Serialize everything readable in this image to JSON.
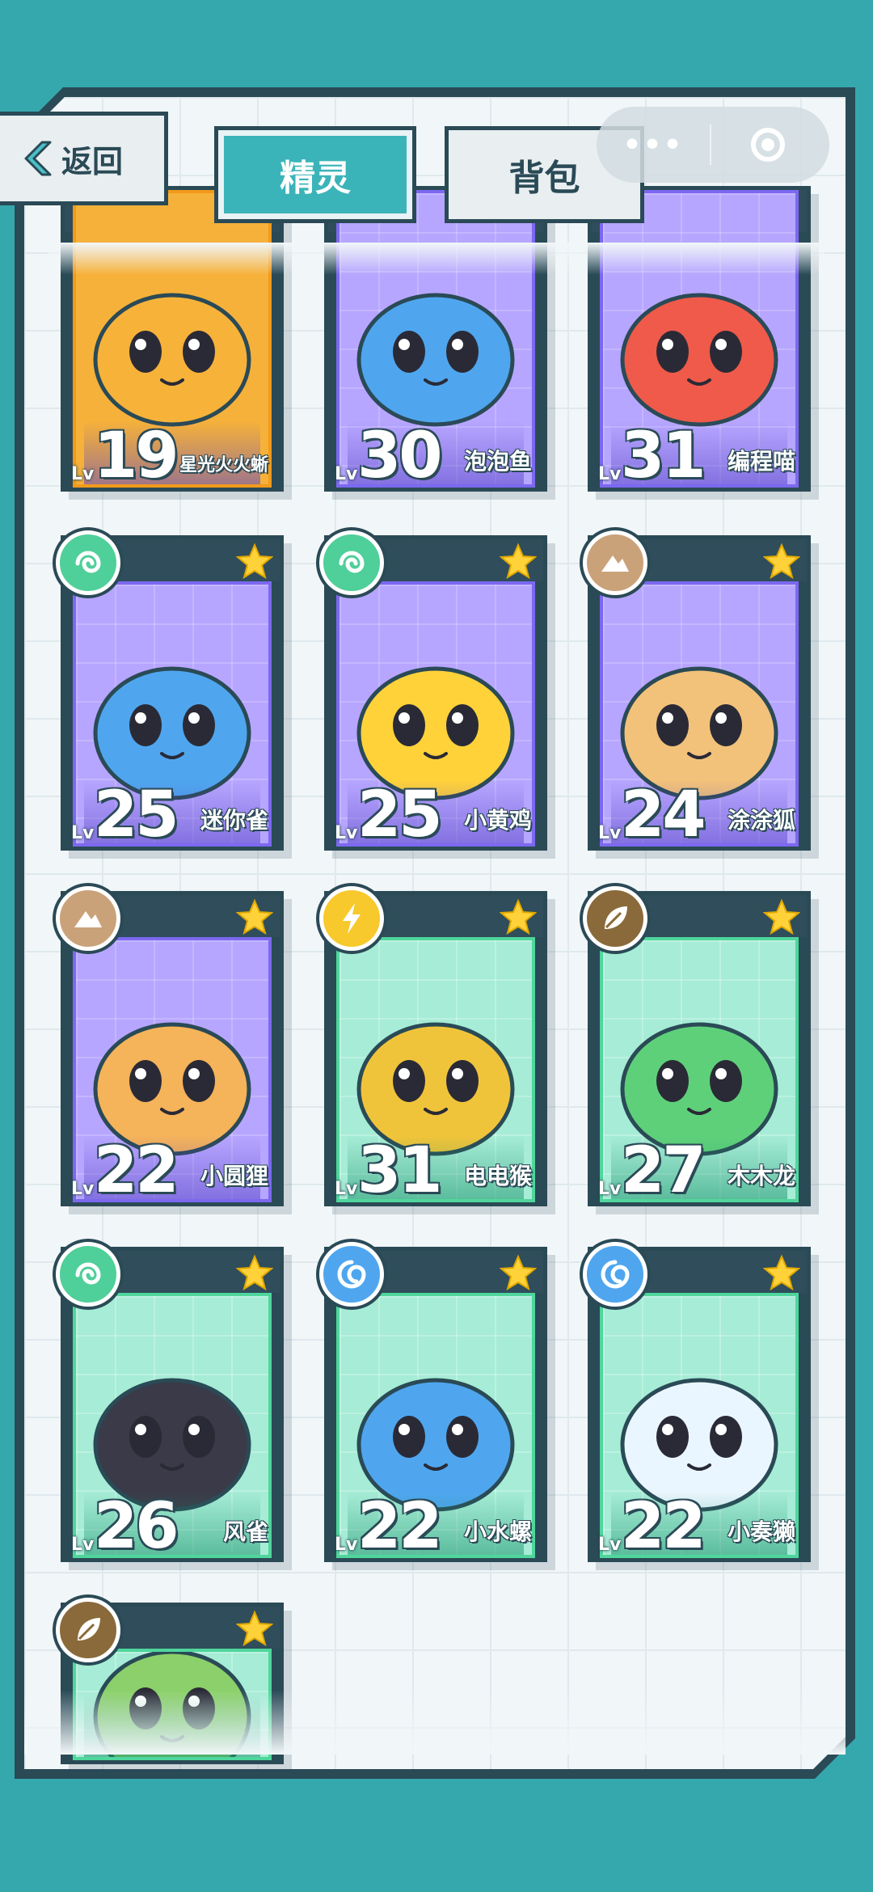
{
  "header": {
    "back_label": "返回",
    "tabs": [
      {
        "label": "精灵",
        "active": true
      },
      {
        "label": "背包",
        "active": false
      }
    ],
    "capsule": {
      "more_icon": "more-dots-icon",
      "close_icon": "close-target-icon"
    }
  },
  "colors": {
    "background": "#35a8ad",
    "frame": "#2a4a56",
    "tab_active": "#3bb4b9",
    "card_purple": "#b7a6ff",
    "card_green": "#a6ecd6",
    "star": "#ffd23a"
  },
  "cards": [
    {
      "name": "星光火火蜥",
      "level": "19",
      "lv_label": "Lv",
      "theme": "orange",
      "element": null,
      "starred": false,
      "color": "#f7b23a"
    },
    {
      "name": "泡泡鱼",
      "level": "30",
      "lv_label": "Lv",
      "theme": "purple",
      "element": null,
      "starred": false,
      "color": "#4fa6ef"
    },
    {
      "name": "编程喵",
      "level": "31",
      "lv_label": "Lv",
      "theme": "purple",
      "element": null,
      "starred": false,
      "color": "#ef5a4a"
    },
    {
      "name": "迷你雀",
      "level": "25",
      "lv_label": "Lv",
      "theme": "purple",
      "element": "wind",
      "starred": true,
      "color": "#4fa6ef"
    },
    {
      "name": "小黄鸡",
      "level": "25",
      "lv_label": "Lv",
      "theme": "purple",
      "element": "wind",
      "starred": true,
      "color": "#ffd23a"
    },
    {
      "name": "涂涂狐",
      "level": "24",
      "lv_label": "Lv",
      "theme": "purple",
      "element": "earth",
      "starred": true,
      "color": "#f2c27a"
    },
    {
      "name": "小圆狸",
      "level": "22",
      "lv_label": "Lv",
      "theme": "purple",
      "element": "earth",
      "starred": true,
      "color": "#f5b35a"
    },
    {
      "name": "电电猴",
      "level": "31",
      "lv_label": "Lv",
      "theme": "green",
      "element": "thunder",
      "starred": true,
      "color": "#f0c43a"
    },
    {
      "name": "木木龙",
      "level": "27",
      "lv_label": "Lv",
      "theme": "green",
      "element": "grass",
      "starred": true,
      "color": "#5fd07a"
    },
    {
      "name": "风雀",
      "level": "26",
      "lv_label": "Lv",
      "theme": "green",
      "element": "wind",
      "starred": true,
      "color": "#3a3a48"
    },
    {
      "name": "小水螺",
      "level": "22",
      "lv_label": "Lv",
      "theme": "green",
      "element": "water",
      "starred": true,
      "color": "#4fa6ef"
    },
    {
      "name": "小奏獭",
      "level": "22",
      "lv_label": "Lv",
      "theme": "green",
      "element": "water",
      "starred": true,
      "color": "#eaf6ff"
    },
    {
      "name": "",
      "level": "",
      "lv_label": "",
      "theme": "green",
      "element": "grass",
      "starred": true,
      "color": "#8bd06a"
    }
  ]
}
